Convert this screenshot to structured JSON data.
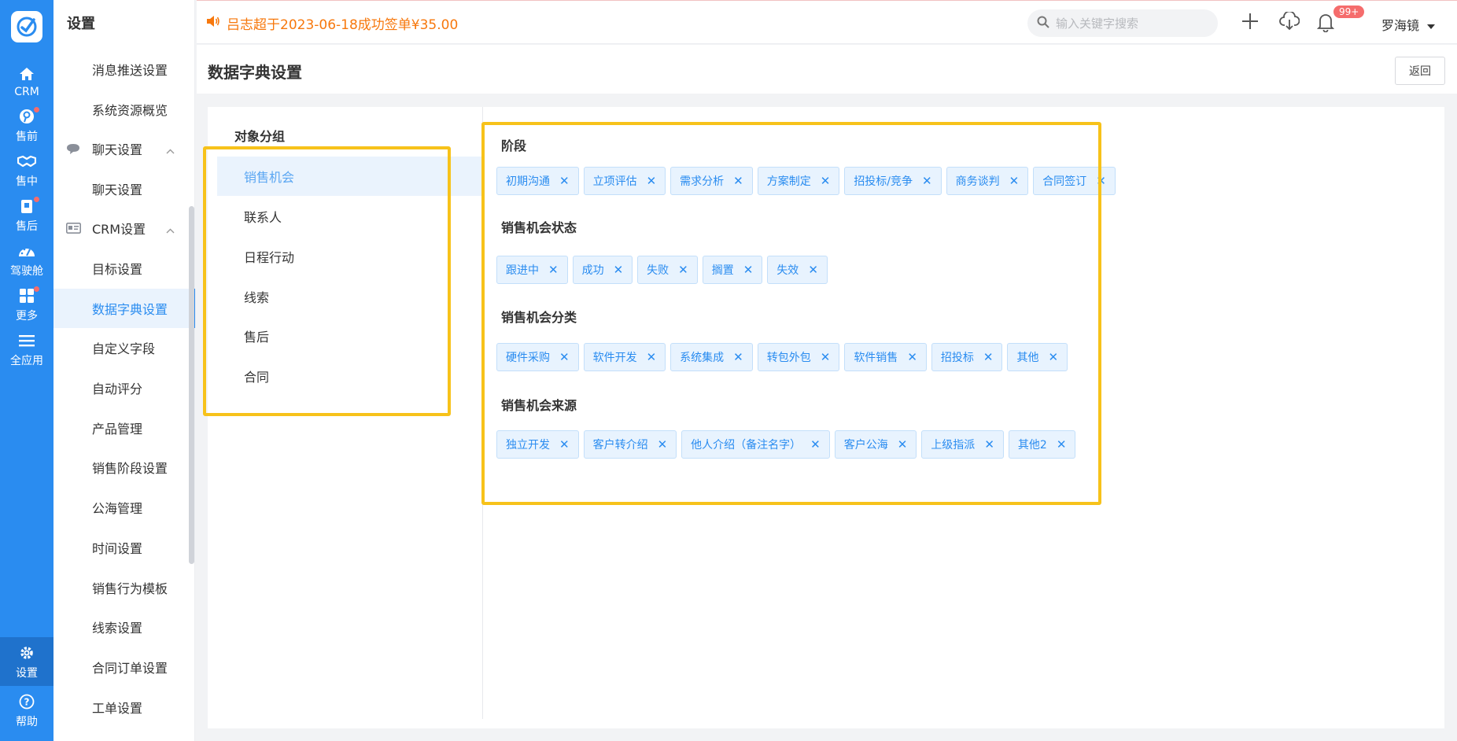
{
  "rail": {
    "items": [
      {
        "label": "CRM",
        "icon": "home-icon",
        "dot": false
      },
      {
        "label": "售前",
        "icon": "pin-icon",
        "dot": true
      },
      {
        "label": "售中",
        "icon": "handshake-icon",
        "dot": false
      },
      {
        "label": "售后",
        "icon": "bag-icon",
        "dot": true
      },
      {
        "label": "驾驶舱",
        "icon": "dashboard-icon",
        "dot": false
      },
      {
        "label": "更多",
        "icon": "grid-icon",
        "dot": true
      },
      {
        "label": "全应用",
        "icon": "menu-icon",
        "dot": false
      },
      {
        "label": "设置",
        "icon": "gear-icon",
        "dot": false
      },
      {
        "label": "帮助",
        "icon": "help-icon",
        "dot": false
      }
    ]
  },
  "sidebar": {
    "title": "设置",
    "items": [
      {
        "label": "消息推送设置"
      },
      {
        "label": "系统资源概览"
      },
      {
        "label": "聊天设置",
        "group": true
      },
      {
        "label": "聊天设置"
      },
      {
        "label": "CRM设置",
        "group": true
      },
      {
        "label": "目标设置"
      },
      {
        "label": "数据字典设置",
        "active": true
      },
      {
        "label": "自定义字段"
      },
      {
        "label": "自动评分"
      },
      {
        "label": "产品管理"
      },
      {
        "label": "销售阶段设置"
      },
      {
        "label": "公海管理"
      },
      {
        "label": "时间设置"
      },
      {
        "label": "销售行为模板"
      },
      {
        "label": "线索设置"
      },
      {
        "label": "合同订单设置"
      },
      {
        "label": "工单设置"
      }
    ]
  },
  "topbar": {
    "notice": "吕志超于2023-06-18成功签单¥35.00",
    "search_placeholder": "输入关键字搜索",
    "badge": "99+",
    "username": "罗海镜"
  },
  "page": {
    "title": "数据字典设置",
    "back_label": "返回"
  },
  "objects": {
    "title": "对象分组",
    "items": [
      "销售机会",
      "联系人",
      "日程行动",
      "线索",
      "售后",
      "合同"
    ]
  },
  "sections": [
    {
      "title": "阶段",
      "tags": [
        "初期沟通",
        "立项评估",
        "需求分析",
        "方案制定",
        "招投标/竞争",
        "商务谈判",
        "合同签订"
      ]
    },
    {
      "title": "销售机会状态",
      "tags": [
        "跟进中",
        "成功",
        "失败",
        "搁置",
        "失效"
      ]
    },
    {
      "title": "销售机会分类",
      "tags": [
        "硬件采购",
        "软件开发",
        "系统集成",
        "转包外包",
        "软件销售",
        "招投标",
        "其他"
      ]
    },
    {
      "title": "销售机会来源",
      "tags": [
        "独立开发",
        "客户转介绍",
        "他人介绍（备注名字）",
        "客户公海",
        "上级指派",
        "其他2"
      ]
    }
  ],
  "colors": {
    "brand": "#2a8cf0",
    "notice": "#f7780d",
    "highlight": "#f7c21a",
    "badge": "#f56c6c"
  }
}
